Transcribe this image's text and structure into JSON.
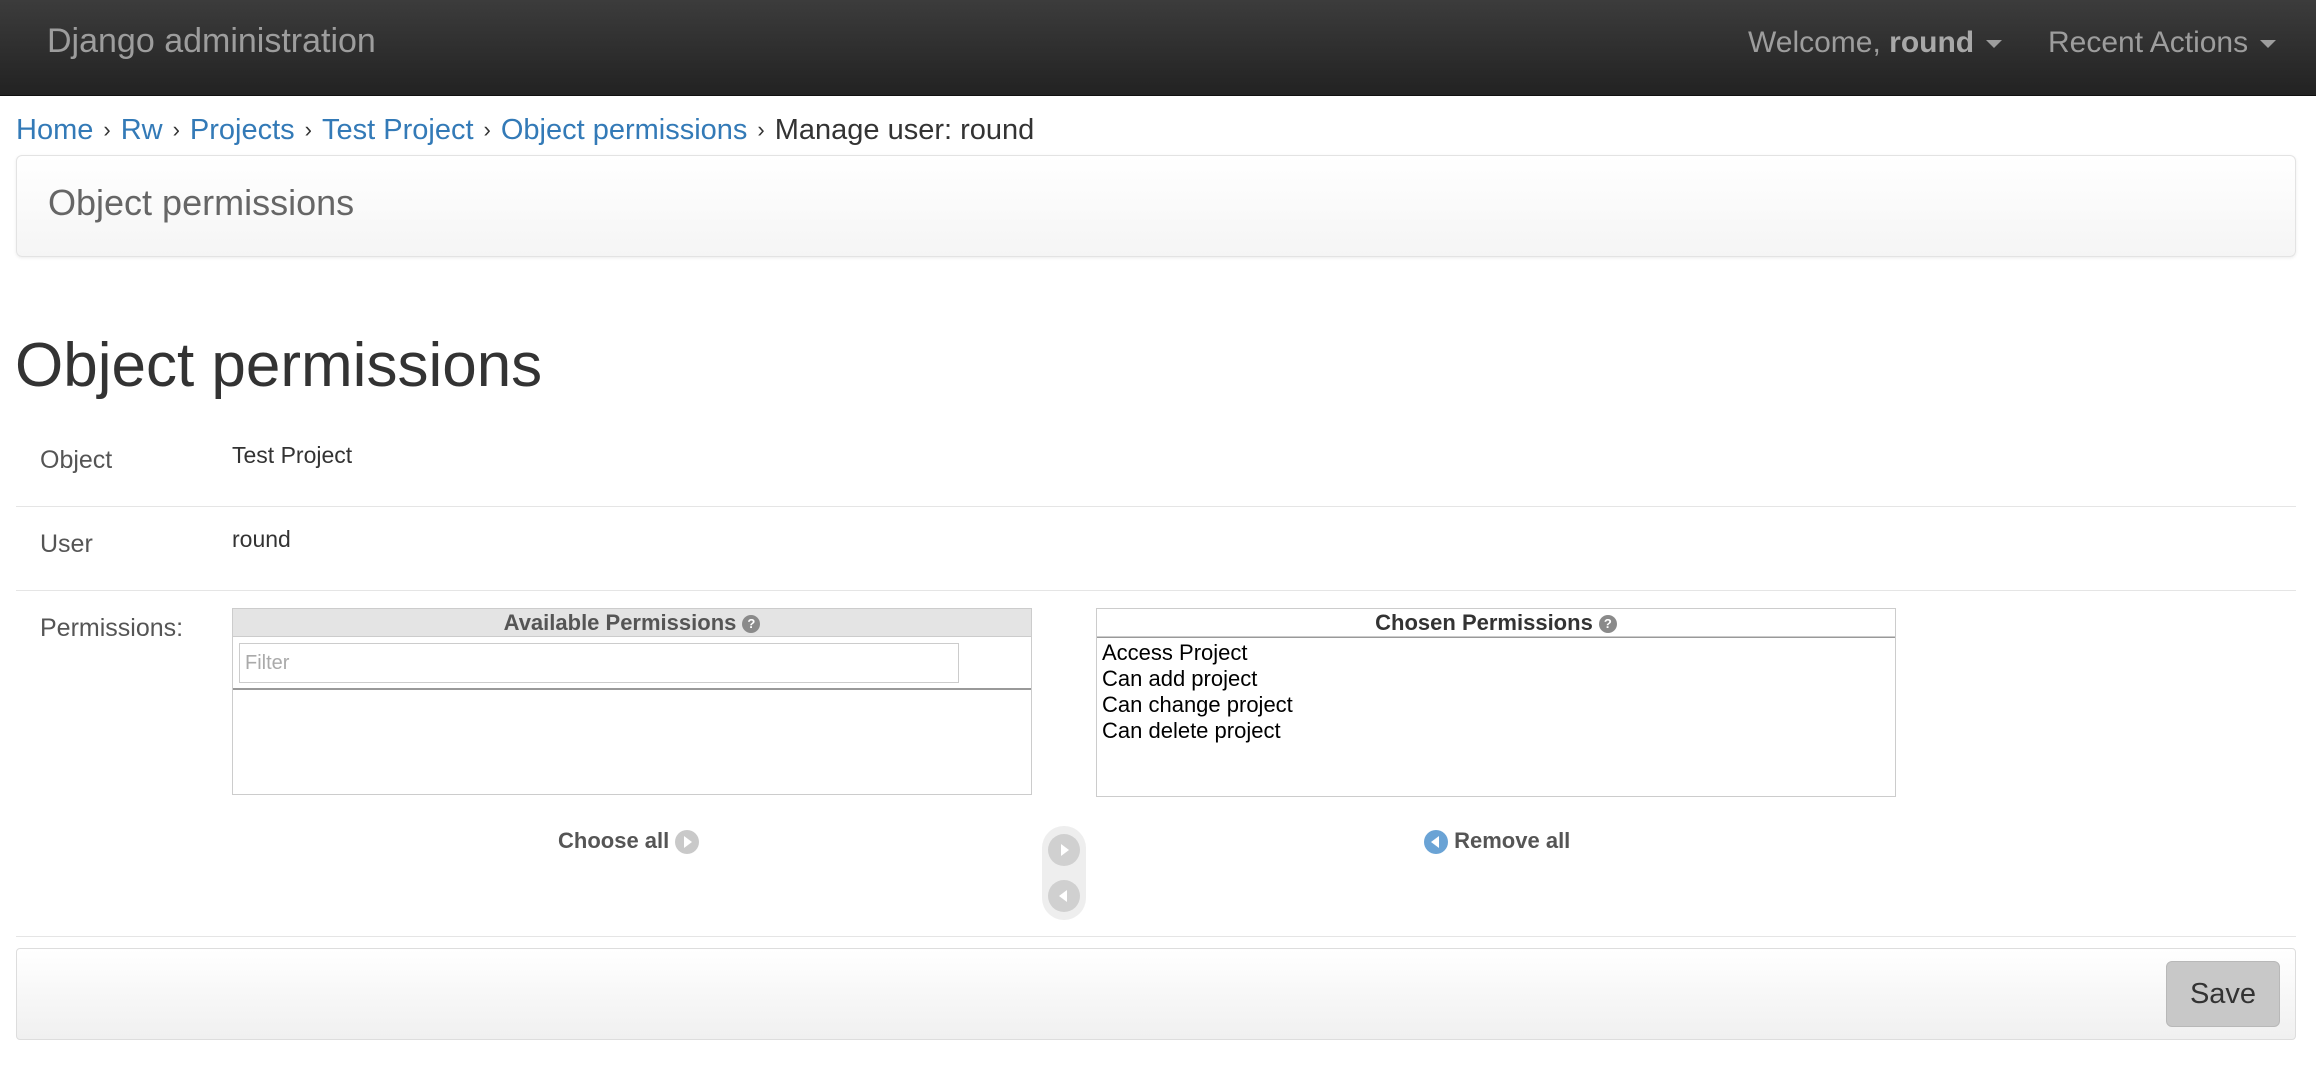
{
  "navbar": {
    "brand": "Django administration",
    "welcome_prefix": "Welcome, ",
    "username": "round",
    "recent_actions": "Recent Actions"
  },
  "breadcrumb": {
    "items": [
      "Home",
      "Rw",
      "Projects",
      "Test Project",
      "Object permissions"
    ],
    "separator": "›",
    "current": "Manage user: round"
  },
  "panel": {
    "title": "Object permissions"
  },
  "page": {
    "title": "Object permissions"
  },
  "form": {
    "object_label": "Object",
    "object_value": "Test Project",
    "user_label": "User",
    "user_value": "round",
    "permissions_label": "Permissions:"
  },
  "selector": {
    "available_title": "Available Permissions",
    "filter_placeholder": "Filter",
    "available_options": [],
    "chosen_title": "Chosen Permissions",
    "chosen_options": [
      "Access Project",
      "Can add project",
      "Can change project",
      "Can delete project"
    ],
    "choose_all": "Choose all",
    "remove_all": "Remove all",
    "help_glyph": "?"
  },
  "submit": {
    "save_label": "Save"
  },
  "icons": {
    "nav_caret": "caret-down-icon",
    "help": "help-icon",
    "choose_all": "arrow-right-circle-icon",
    "remove_all": "arrow-left-circle-icon"
  },
  "colors": {
    "navbar_bg": "#222222",
    "link": "#337ab7",
    "text": "#333333",
    "accent_blue": "#6aa3d5"
  }
}
